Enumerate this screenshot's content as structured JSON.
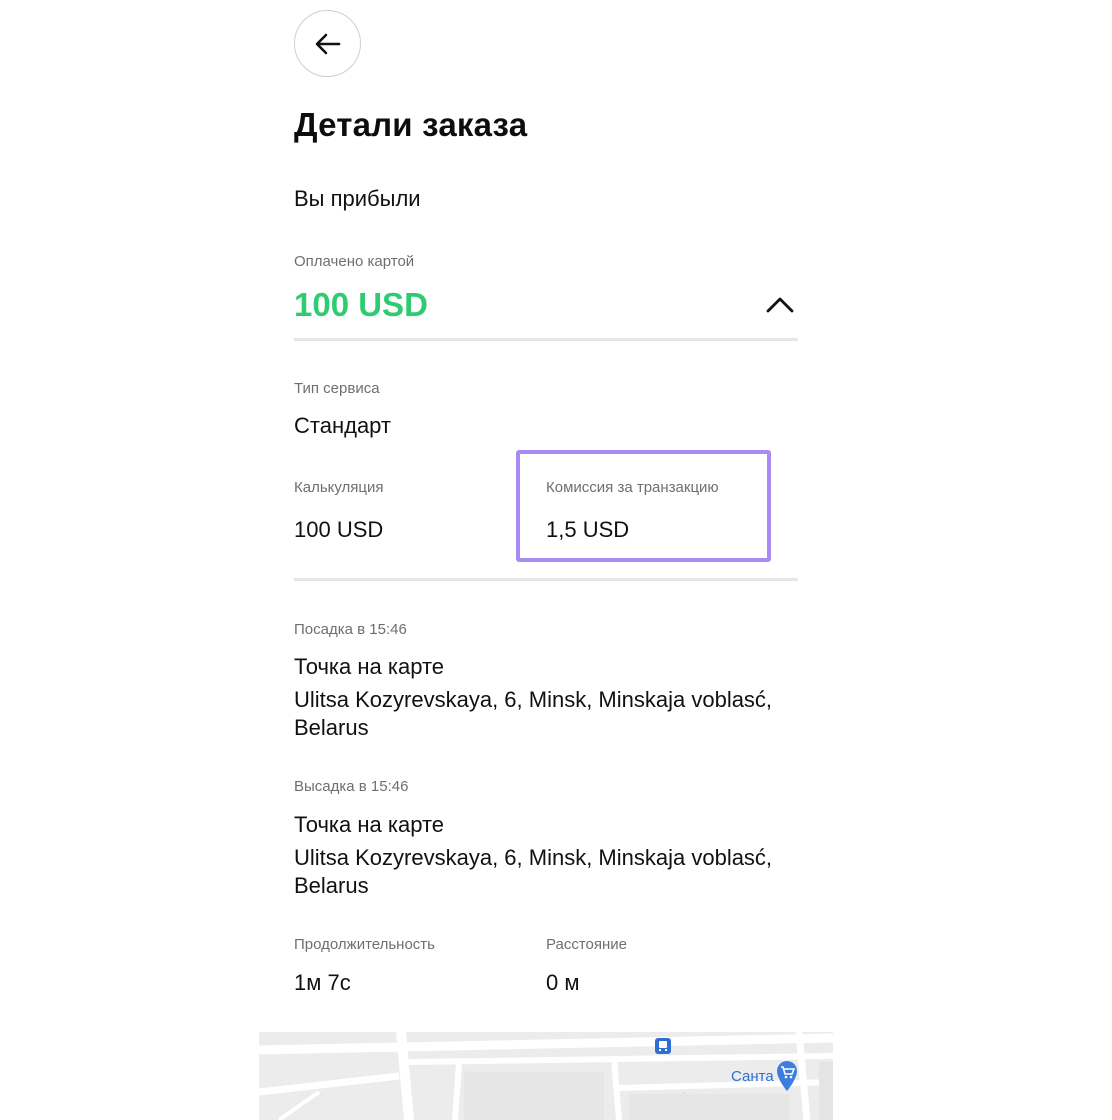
{
  "header": {
    "back_icon": "arrow-left-icon",
    "title": "Детали заказа"
  },
  "status": "Вы прибыли",
  "payment": {
    "label": "Оплачено картой",
    "amount": "100 USD",
    "amount_color": "#2ecc71",
    "toggle_icon": "chevron-up-icon"
  },
  "service": {
    "label": "Тип сервиса",
    "value": "Стандарт"
  },
  "calculation": {
    "label": "Калькуляция",
    "value": "100 USD"
  },
  "commission": {
    "label": "Комиссия за транзакцию",
    "value": "1,5 USD",
    "highlight_color": "#a98af2"
  },
  "pickup": {
    "label": "Посадка в 15:46",
    "title": "Точка на карте",
    "address": "Ulitsa Kozyrevskaya, 6, Minsk, Minskaja voblasć, Belarus"
  },
  "dropoff": {
    "label": "Высадка в 15:46",
    "title": "Точка на карте",
    "address": "Ulitsa Kozyrevskaya, 6, Minsk, Minskaja voblasć, Belarus"
  },
  "trip": {
    "duration_label": "Продолжительность",
    "duration_value": "1м 7с",
    "distance_label": "Расстояние",
    "distance_value": "0 м"
  },
  "map": {
    "place_label": "Санта",
    "icons": [
      "bus-stop-icon",
      "shopping-cart-pin-icon"
    ]
  }
}
